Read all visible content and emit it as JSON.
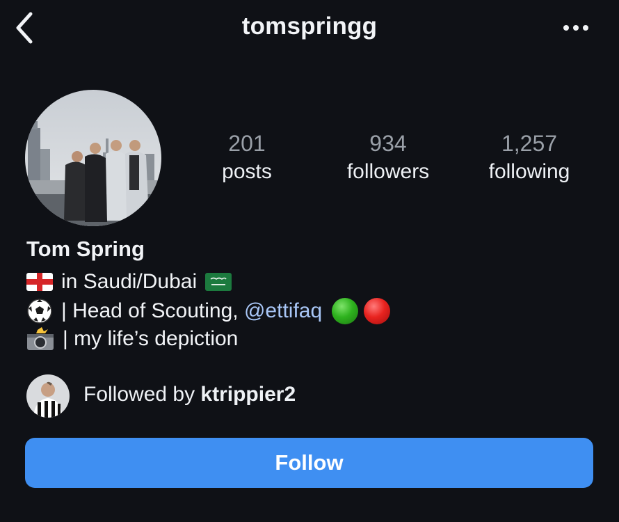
{
  "header": {
    "username": "tomspringg",
    "back_icon": "chevron-left-icon",
    "more_icon": "more-horizontal-icon"
  },
  "profile": {
    "avatar_icon": "profile-photo-group-city",
    "stats": {
      "posts": {
        "count": "201",
        "label": "posts"
      },
      "followers": {
        "count": "934",
        "label": "followers"
      },
      "following": {
        "count": "1,257",
        "label": "following"
      }
    },
    "name": "Tom Spring",
    "bio": {
      "line1": {
        "emoji_left": "england-flag-icon",
        "text": "in Saudi/Dubai",
        "emoji_right": "saudi-flag-icon"
      },
      "line2": {
        "emoji_left": "soccer-ball-icon",
        "text": "| Head of Scouting, ",
        "mention": "@ettifaq",
        "emoji_right": [
          "green-circle-icon",
          "red-circle-icon"
        ]
      },
      "line3": {
        "emoji_left": "camera-flash-icon",
        "text": "| my life’s depiction"
      }
    },
    "followed_by": {
      "prefix": "Followed by",
      "user": "ktrippier2",
      "avatar_icon": "follower-photo"
    },
    "follow_button": "Follow"
  },
  "colors": {
    "background": "#0f1116",
    "accent": "#3f8ff2",
    "mention": "#a9c7f7",
    "muted": "#9aa0a8"
  }
}
